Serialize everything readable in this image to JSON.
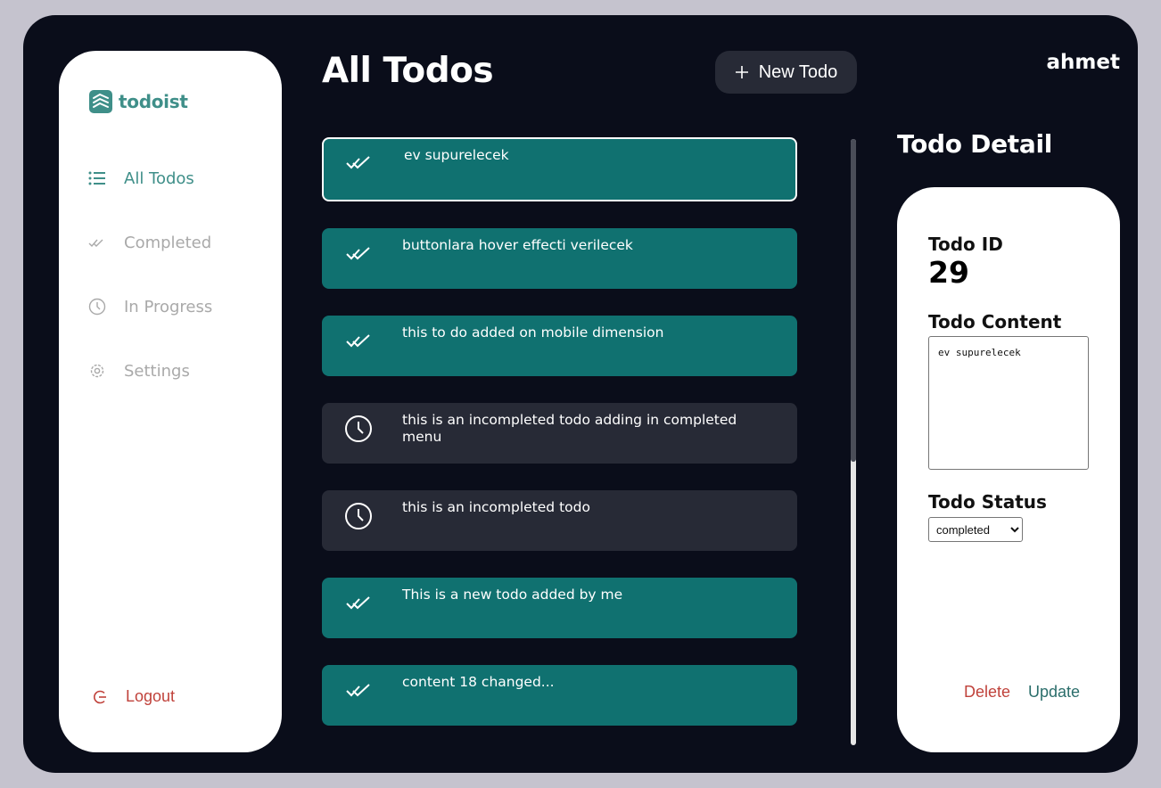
{
  "app": {
    "logo_text": "todoist",
    "username": "ahmet",
    "page_title": "All Todos",
    "new_todo_label": "New Todo"
  },
  "sidebar": {
    "items": [
      {
        "label": "All Todos",
        "icon": "list-icon",
        "active": true
      },
      {
        "label": "Completed",
        "icon": "double-check-icon",
        "active": false
      },
      {
        "label": "In Progress",
        "icon": "clock-icon",
        "active": false
      },
      {
        "label": "Settings",
        "icon": "gear-icon",
        "active": false
      }
    ],
    "logout_label": "Logout"
  },
  "todos": [
    {
      "text": "ev supurelecek",
      "status": "completed",
      "selected": true
    },
    {
      "text": "buttonlara hover effecti verilecek",
      "status": "completed",
      "selected": false
    },
    {
      "text": "this to do added on mobile dimension",
      "status": "completed",
      "selected": false
    },
    {
      "text": "this is an incompleted todo adding in completed menu",
      "status": "in-progress",
      "selected": false
    },
    {
      "text": "this is an incompleted todo",
      "status": "in-progress",
      "selected": false
    },
    {
      "text": "This is a new todo added by me",
      "status": "completed",
      "selected": false
    },
    {
      "text": "content 18 changed...",
      "status": "completed",
      "selected": false
    }
  ],
  "detail": {
    "title": "Todo Detail",
    "id_label": "Todo ID",
    "id_value": "29",
    "content_label": "Todo Content",
    "content_value": "ev supurelecek",
    "status_label": "Todo Status",
    "status_value": "completed",
    "delete_label": "Delete",
    "update_label": "Update"
  },
  "colors": {
    "background": "#0a0d1a",
    "accent_teal": "#107170",
    "in_progress": "#272a36",
    "logo_green": "#3f8f89",
    "danger": "#c0423b"
  }
}
